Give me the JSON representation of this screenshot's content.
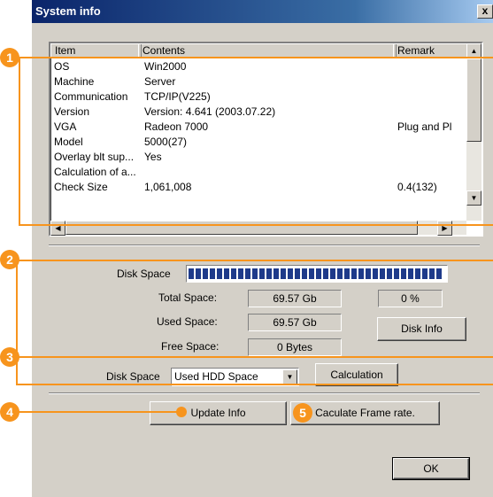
{
  "window": {
    "title": "System info",
    "close_label": "x"
  },
  "list": {
    "columns": [
      "Item",
      "Contents",
      "Remark"
    ],
    "rows": [
      {
        "item": "OS",
        "contents": "Win2000",
        "remark": ""
      },
      {
        "item": "Machine",
        "contents": "Server",
        "remark": ""
      },
      {
        "item": "Communication",
        "contents": "TCP/IP(V225)",
        "remark": ""
      },
      {
        "item": "Version",
        "contents": "Version: 4.641 (2003.07.22)",
        "remark": ""
      },
      {
        "item": "VGA",
        "contents": "Radeon 7000",
        "remark": "Plug and Pl"
      },
      {
        "item": "Model",
        "contents": "5000(27)",
        "remark": ""
      },
      {
        "item": "Overlay blt sup...",
        "contents": "Yes",
        "remark": ""
      },
      {
        "item": "Calculation of a...",
        "contents": "",
        "remark": ""
      },
      {
        "item": "Check Size",
        "contents": "1,061,008",
        "remark": "0.4(132)"
      }
    ]
  },
  "disk": {
    "label": "Disk Space",
    "progress_percent": 100,
    "total_label": "Total Space:",
    "total_value": "69.57 Gb",
    "percent_value": "0 %",
    "used_label": "Used Space:",
    "used_value": "69.57 Gb",
    "free_label": "Free Space:",
    "free_value": "0 Bytes",
    "info_button": "Disk Info"
  },
  "calc": {
    "label": "Disk Space",
    "select_value": "Used HDD Space",
    "button": "Calculation"
  },
  "actions": {
    "update": "Update Info",
    "frame_rate": "Caculate Frame rate.",
    "ok": "OK"
  },
  "annotations": [
    "1",
    "2",
    "3",
    "4",
    "5"
  ],
  "colors": {
    "accent": "#f7941d",
    "titlebar": "#0a246a",
    "progress": "#1e3a8a"
  }
}
